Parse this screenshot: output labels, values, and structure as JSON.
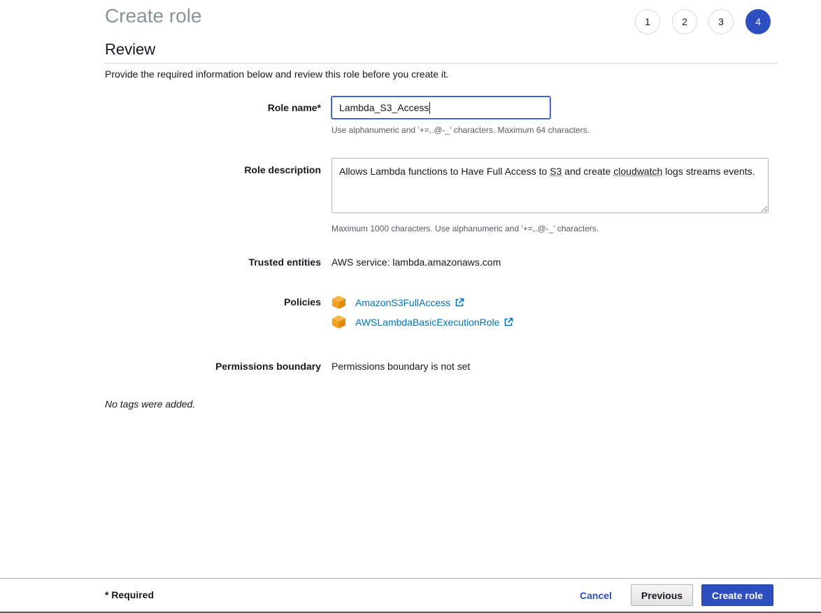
{
  "header": {
    "title": "Create role",
    "steps": [
      "1",
      "2",
      "3",
      "4"
    ],
    "active_step": 4
  },
  "review": {
    "heading": "Review",
    "intro": "Provide the required information below and review this role before you create it."
  },
  "form": {
    "role_name": {
      "label": "Role name*",
      "value": "Lambda_S3_Access",
      "hint": "Use alphanumeric and '+=,.@-_' characters. Maximum 64 characters."
    },
    "role_description": {
      "label": "Role description",
      "text_before": "Allows Lambda functions to Have Full Access to ",
      "word_s3": "S3",
      "text_middle": " and create ",
      "word_cloudwatch": "cloudwatch",
      "text_after": " logs streams events.",
      "hint": "Maximum 1000 characters. Use alphanumeric and '+=,.@-_' characters."
    },
    "trusted_entities": {
      "label": "Trusted entities",
      "value": "AWS service: lambda.amazonaws.com"
    },
    "policies": {
      "label": "Policies",
      "items": [
        {
          "name": "AmazonS3FullAccess",
          "icon": "aws-policy-cube-icon"
        },
        {
          "name": "AWSLambdaBasicExecutionRole",
          "icon": "aws-policy-cube-icon"
        }
      ]
    },
    "permissions_boundary": {
      "label": "Permissions boundary",
      "value": "Permissions boundary is not set"
    },
    "tags_note": "No tags were added."
  },
  "footer": {
    "required_note": "* Required",
    "cancel_label": "Cancel",
    "previous_label": "Previous",
    "create_label": "Create role"
  },
  "colors": {
    "accent": "#2e4fbf",
    "link": "#0073bb",
    "policy_icon": "#f3a01d",
    "muted_title": "#879596"
  }
}
